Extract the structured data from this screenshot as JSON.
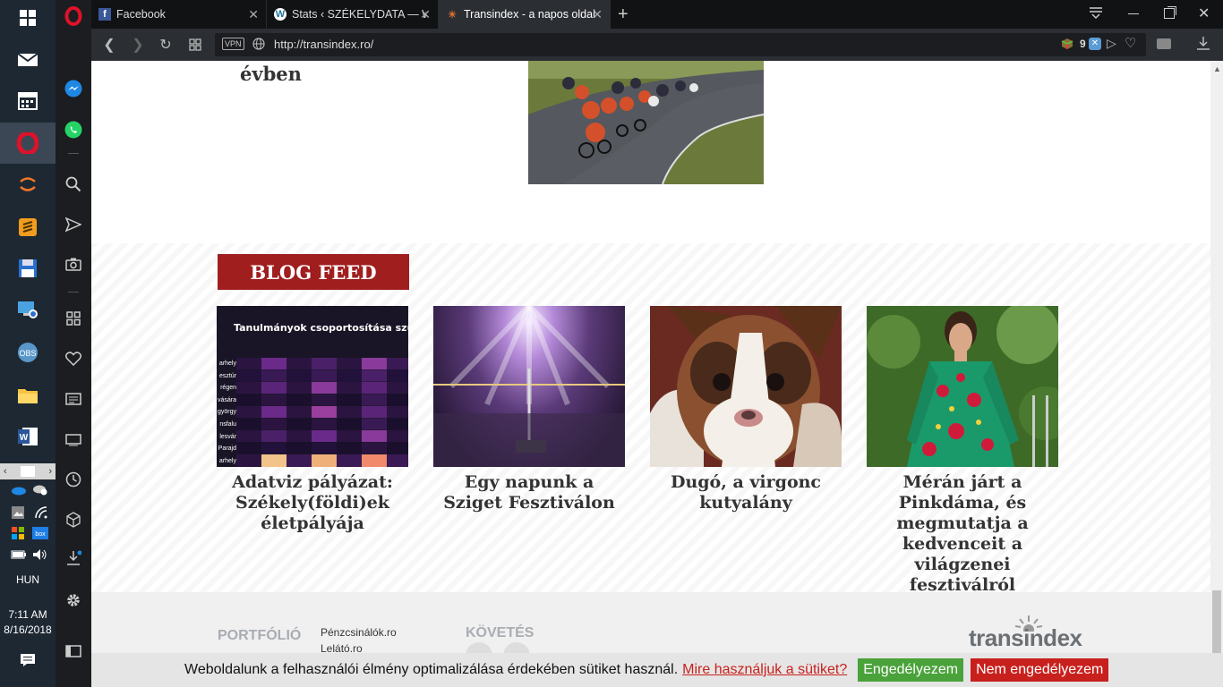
{
  "taskbar": {
    "language": "HUN",
    "time": "7:11 AM",
    "date": "8/16/2018"
  },
  "browser": {
    "tabs": [
      {
        "label": "Facebook",
        "icon": "facebook-icon"
      },
      {
        "label": "Stats ‹ SZÉKELYDATA — W",
        "icon": "wordpress-icon"
      },
      {
        "label": "Transindex - a napos oldal",
        "icon": "transindex-icon"
      }
    ],
    "address": {
      "vpn": "VPN",
      "url": "http://transindex.ro/",
      "badge_count": "9"
    }
  },
  "page": {
    "prev_article_tail": "évben",
    "blog_feed": {
      "heading": "BLOG FEED",
      "cards": [
        {
          "title": "Adatviz pályázat: Székely(földi)ek életpályája",
          "image_caption": "Tanulmányok csoportosítása szül",
          "row_labels": [
            "arhely",
            "esztúr",
            "régen",
            "vására",
            "györgy",
            "nsfalu",
            "lesvár",
            "Parajd",
            "arhely"
          ]
        },
        {
          "title": "Egy napunk a Sziget Fesztiválon"
        },
        {
          "title": "Dugó, a virgonc kutyalány"
        },
        {
          "title": "Mérán járt a Pinkdáma, és megmutatja a kedvenceit a világzenei fesztiválról"
        }
      ]
    },
    "footer": {
      "portfolio_label": "PORTFÓLIÓ",
      "links": [
        "Pénzcsinálók.ro",
        "Lelátó.ro"
      ],
      "follow_label": "KÖVETÉS",
      "logo": "transindex"
    }
  },
  "cookie_bar": {
    "text": "Weboldalunk a felhasználói élmény optimalizálása érdekében sütiket használ.",
    "link": "Mire használjuk a sütiket?",
    "accept": "Engedélyezem",
    "decline": "Nem engedélyezem"
  },
  "colors": {
    "accent": "#a01e1e",
    "accept_green": "#4aa23a",
    "decline_red": "#c8211d"
  }
}
